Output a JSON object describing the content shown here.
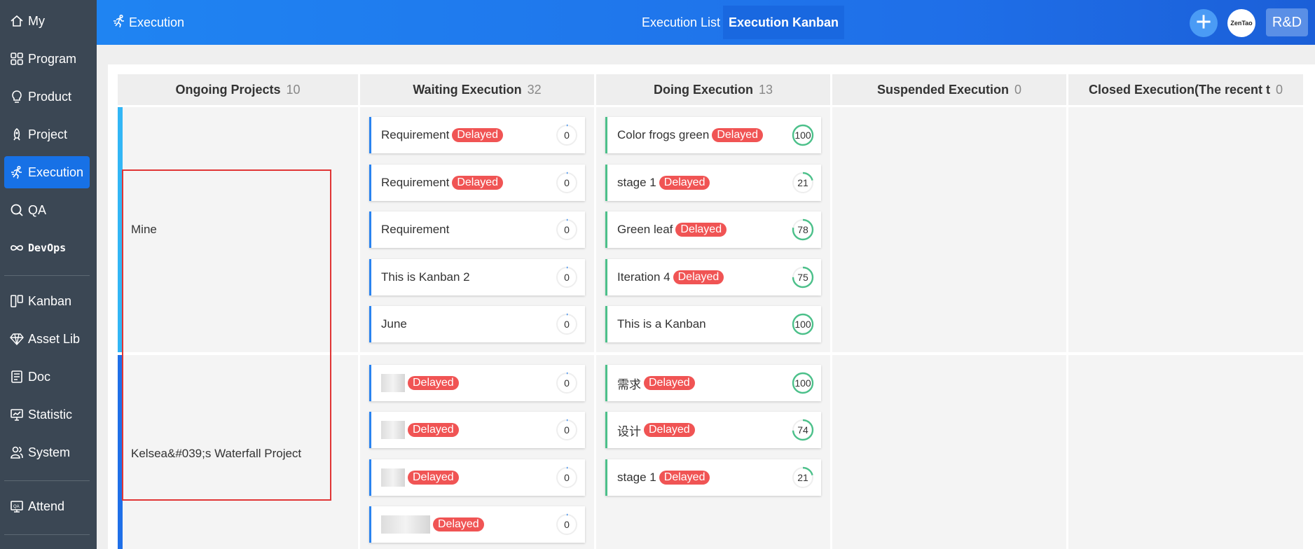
{
  "sidebar": {
    "items": [
      {
        "label": "My",
        "icon": "home-icon"
      },
      {
        "label": "Program",
        "icon": "grid-icon"
      },
      {
        "label": "Product",
        "icon": "bulb-icon"
      },
      {
        "label": "Project",
        "icon": "rocket-icon"
      },
      {
        "label": "Execution",
        "icon": "runner-icon",
        "active": true
      },
      {
        "label": "QA",
        "icon": "search-bug-icon"
      },
      {
        "label": "DevOps",
        "icon": "infinity-icon"
      },
      {
        "label": "Kanban",
        "icon": "kanban-icon"
      },
      {
        "label": "Asset Lib",
        "icon": "diamond-icon"
      },
      {
        "label": "Doc",
        "icon": "doc-icon"
      },
      {
        "label": "Statistic",
        "icon": "monitor-chart-icon"
      },
      {
        "label": "System",
        "icon": "users-icon"
      },
      {
        "label": "Attend",
        "icon": "attend-icon"
      }
    ]
  },
  "header": {
    "breadcrumb": "Execution",
    "tabs": [
      {
        "label": "Execution List"
      },
      {
        "label": "Execution Kanban",
        "active": true
      }
    ],
    "avatar_text": "ZenTao",
    "rd_button": "R&D"
  },
  "board": {
    "columns": [
      {
        "title": "Ongoing Projects",
        "count": "10"
      },
      {
        "title": "Waiting Execution",
        "count": "32"
      },
      {
        "title": "Doing Execution",
        "count": "13"
      },
      {
        "title": "Suspended Execution",
        "count": "0"
      },
      {
        "title": "Closed Execution(The recent t",
        "count": "0"
      }
    ],
    "lanes": [
      {
        "name": "Mine",
        "bar_color": "#32b6f5",
        "waiting": [
          {
            "title": "Requirement",
            "badge": "Delayed",
            "progress": 0
          },
          {
            "title": "Requirement",
            "badge": "Delayed",
            "progress": 0
          },
          {
            "title": "Requirement",
            "badge": "",
            "progress": 0
          },
          {
            "title": "This is Kanban 2",
            "badge": "",
            "progress": 0
          },
          {
            "title": "June",
            "badge": "",
            "progress": 0
          }
        ],
        "doing": [
          {
            "title": "Color frogs green",
            "badge": "Delayed",
            "progress": 100
          },
          {
            "title": "stage 1",
            "badge": "Delayed",
            "progress": 21
          },
          {
            "title": "Green leaf",
            "badge": "Delayed",
            "progress": 78
          },
          {
            "title": "Iteration 4",
            "badge": "Delayed",
            "progress": 75
          },
          {
            "title": "This is a Kanban",
            "badge": "",
            "progress": 100
          }
        ]
      },
      {
        "name": "Kelsea&#039;s Waterfall Project",
        "bar_color": "#1f6fe8",
        "waiting": [
          {
            "title": "",
            "badge": "Delayed",
            "progress": 0,
            "blurred": true
          },
          {
            "title": "",
            "badge": "Delayed",
            "progress": 0,
            "blurred": true
          },
          {
            "title": "",
            "badge": "Delayed",
            "progress": 0,
            "blurred": true
          },
          {
            "title": "",
            "badge": "Delayed",
            "progress": 0,
            "blurred": true
          }
        ],
        "doing": [
          {
            "title": "需求",
            "badge": "Delayed",
            "progress": 100
          },
          {
            "title": "设计",
            "badge": "Delayed",
            "progress": 74
          },
          {
            "title": "stage 1",
            "badge": "Delayed",
            "progress": 21
          }
        ]
      }
    ]
  },
  "colors": {
    "accent": "#1771e6",
    "delayed": "#f05454",
    "progress_green": "#4cc08a",
    "waiting_border": "#2a83ef"
  }
}
